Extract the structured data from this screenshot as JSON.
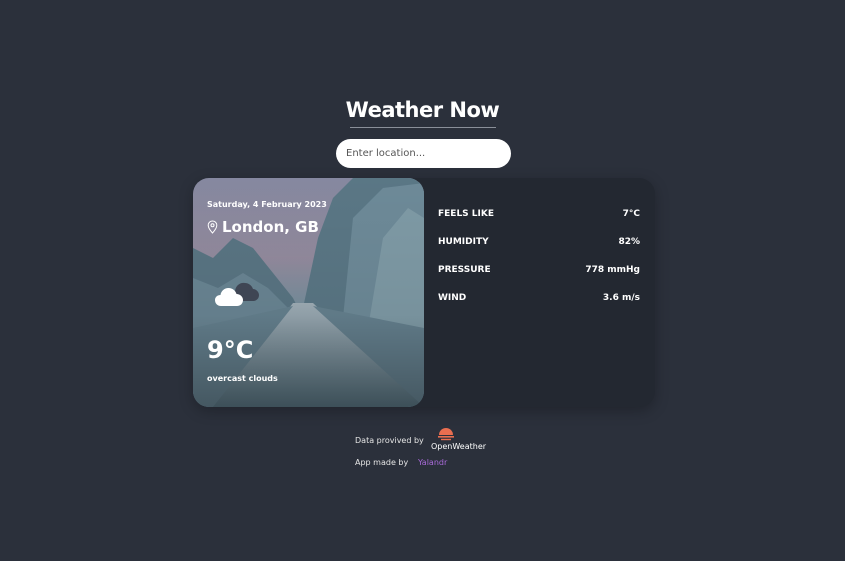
{
  "header": {
    "title": "Weather Now"
  },
  "search": {
    "placeholder": "Enter location..."
  },
  "weather": {
    "date": "Saturday, 4 February 2023",
    "location": "London, GB",
    "temperature": "9°C",
    "description": "overcast clouds",
    "icon": "cloud-icon"
  },
  "stats": [
    {
      "label": "FEELS LIKE",
      "value": "7°C"
    },
    {
      "label": "HUMIDITY",
      "value": "82%"
    },
    {
      "label": "PRESSURE",
      "value": "778 mmHg"
    },
    {
      "label": "WIND",
      "value": "3.6 m/s"
    }
  ],
  "footer": {
    "data_provided_by": "Data provived by",
    "provider": "OpenWeather",
    "app_made_by": "App made by",
    "author": "Yalandr"
  },
  "colors": {
    "background": "#2b303b",
    "card": "#232831",
    "author_link": "#a96ad9",
    "provider_logo": "#e96e50"
  }
}
